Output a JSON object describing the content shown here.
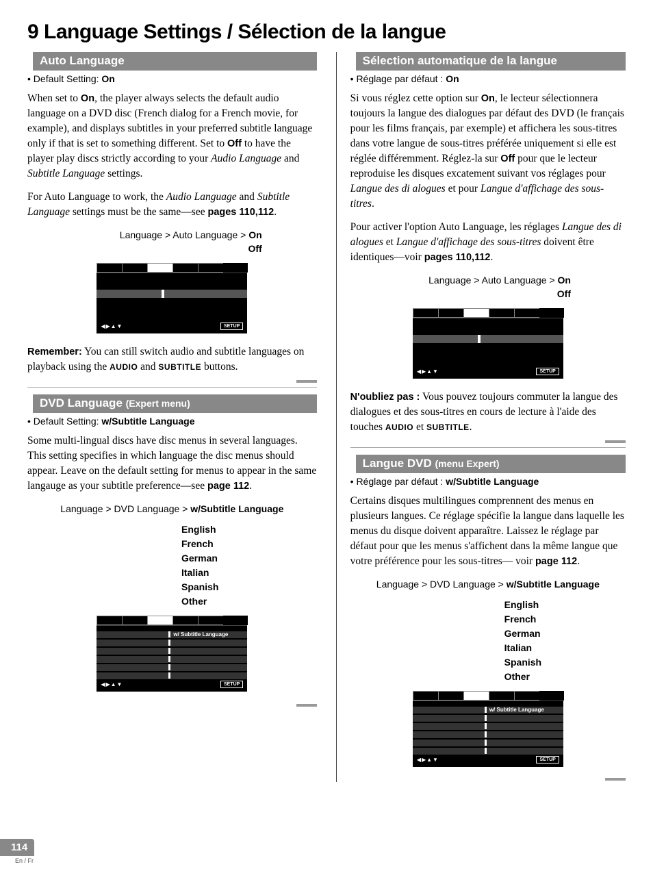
{
  "page": {
    "number": "114",
    "lang_indicator": "En / Fr",
    "chapter_title": "9 Language Settings / Sélection de la langue"
  },
  "left": {
    "auto_language": {
      "heading": "Auto Language",
      "default_prefix": "• Default Setting: ",
      "default_value": "On",
      "para1_a": "When set to ",
      "para1_b": "On",
      "para1_c": ", the player always selects the default audio language on a DVD disc (French dialog for a French movie, for example), and displays subtitles in your preferred subtitle language only if that is set to something different. Set to ",
      "para1_d": "Off",
      "para1_e": " to have the player play discs strictly according to your ",
      "para1_f": "Audio Language",
      "para1_g": " and ",
      "para1_h": "Subtitle Language",
      "para1_i": " settings.",
      "para2_a": "For Auto Language to work, the ",
      "para2_b": "Audio Language",
      "para2_c": " and ",
      "para2_d": "Subtitle Language",
      "para2_e": " settings must be the same—see ",
      "para2_f": "pages 110,112",
      "para2_g": ".",
      "menu_path_a": "Language > Auto Language > ",
      "menu_path_on": "On",
      "menu_path_off": "Off",
      "remember_kw": "Remember:",
      "remember_a": " You can still switch audio and subtitle languages on playback using the ",
      "remember_b": "AUDIO",
      "remember_c": " and ",
      "remember_d": "SUBTITLE",
      "remember_e": " buttons."
    },
    "dvd_language": {
      "heading": "DVD Language ",
      "subhead": "(Expert menu)",
      "default_prefix": "• Default Setting: ",
      "default_value": "w/Subtitle Language",
      "para_a": "Some multi-lingual discs have disc menus in several languages. This setting specifies in which language the disc menus should appear. Leave on the default setting for menus to appear in the same langauge as your subtitle preference—see ",
      "para_b": "page 112",
      "para_c": ".",
      "menu_path_a": "Language > DVD Language > ",
      "menu_path_sel": "w/Subtitle Language",
      "options": [
        "English",
        "French",
        "German",
        "Italian",
        "Spanish",
        "Other"
      ],
      "osd_label": "w/ Subtitle Language"
    }
  },
  "right": {
    "auto_language": {
      "heading": "Sélection automatique de la langue",
      "default_prefix": "• Réglage par défaut : ",
      "default_value": "On",
      "para1_a": "Si vous réglez cette option sur ",
      "para1_b": "On",
      "para1_c": ", le lecteur sélectionnera toujours la langue des dialogues par défaut des DVD (le français pour les films français, par exemple) et affichera les sous-titres dans votre langue de sous-titres préférée uniquement si elle est réglée différemment. Réglez-la sur ",
      "para1_d": "Off",
      "para1_e": " pour que le lecteur reproduise les disques excatement suivant vos réglages pour ",
      "para1_f": "Langue des di alogues",
      "para1_g": " et pour ",
      "para1_h": "Langue d'affichage des sous-titres",
      "para1_i": ".",
      "para2_a": "Pour activer l'option Auto Language, les réglages ",
      "para2_b": "Langue des di alogues",
      "para2_c": " et ",
      "para2_d": "Langue d'affichage des sous-titres",
      "para2_e": " doivent être identiques—voir ",
      "para2_f": "pages 110,112",
      "para2_g": ".",
      "menu_path_a": "Language > Auto Language > ",
      "menu_path_on": "On",
      "menu_path_off": "Off",
      "remember_kw": "N'oubliez pas :",
      "remember_a": " Vous pouvez toujours commuter la langue des dialogues et des sous-titres en cours de lecture à l'aide des touches ",
      "remember_b": "AUDIO",
      "remember_c": " et ",
      "remember_d": "SUBTITLE",
      "remember_e": "."
    },
    "dvd_language": {
      "heading": "Langue DVD ",
      "subhead": "(menu Expert)",
      "default_prefix": "• Réglage par défaut : ",
      "default_value": "w/Subtitle Language",
      "para_a": "Certains disques multilingues comprennent des menus en plusieurs langues. Ce réglage spécifie la langue dans laquelle les menus du disque doivent apparaître. Laissez le réglage par défaut pour que les menus s'affichent dans la même langue que votre préférence pour les sous-titres— voir ",
      "para_b": "page 112",
      "para_c": ".",
      "menu_path_a": "Language > DVD Language > ",
      "menu_path_sel": "w/Subtitle Language",
      "options": [
        "English",
        "French",
        "German",
        "Italian",
        "Spanish",
        "Other"
      ],
      "osd_label": "w/ Subtitle Language"
    }
  },
  "osd": {
    "nav": "◀▶▲▼",
    "setup": "SETUP"
  }
}
